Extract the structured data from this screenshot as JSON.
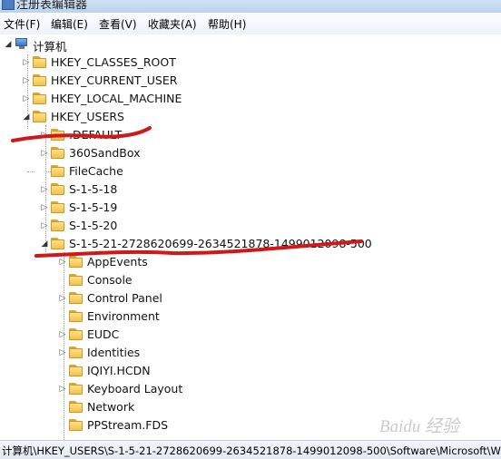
{
  "window": {
    "title": "注册表编辑器"
  },
  "menu": [
    "文件(F)",
    "编辑(E)",
    "查看(V)",
    "收藏夹(A)",
    "帮助(H)"
  ],
  "tree": {
    "root": "计算机",
    "hives": [
      "HKEY_CLASSES_ROOT",
      "HKEY_CURRENT_USER",
      "HKEY_LOCAL_MACHINE",
      "HKEY_USERS"
    ],
    "users_children": [
      ".DEFAULT",
      "360SandBox",
      "FileCache",
      "S-1-5-18",
      "S-1-5-19",
      "S-1-5-20",
      "S-1-5-21-2728620699-2634521878-1499012098-500"
    ],
    "sid_children": [
      "AppEvents",
      "Console",
      "Control Panel",
      "Environment",
      "EUDC",
      "Identities",
      "IQIYI.HCDN",
      "Keyboard Layout",
      "Network",
      "PPStream.FDS"
    ]
  },
  "status": {
    "path": "计算机\\HKEY_USERS\\S-1-5-21-2728620699-2634521878-1499012098-500\\Software\\Microsoft\\W"
  },
  "colors": {
    "annotation": "#d01818",
    "folder": "#f2c14b"
  },
  "watermark": "Baidu 经验"
}
